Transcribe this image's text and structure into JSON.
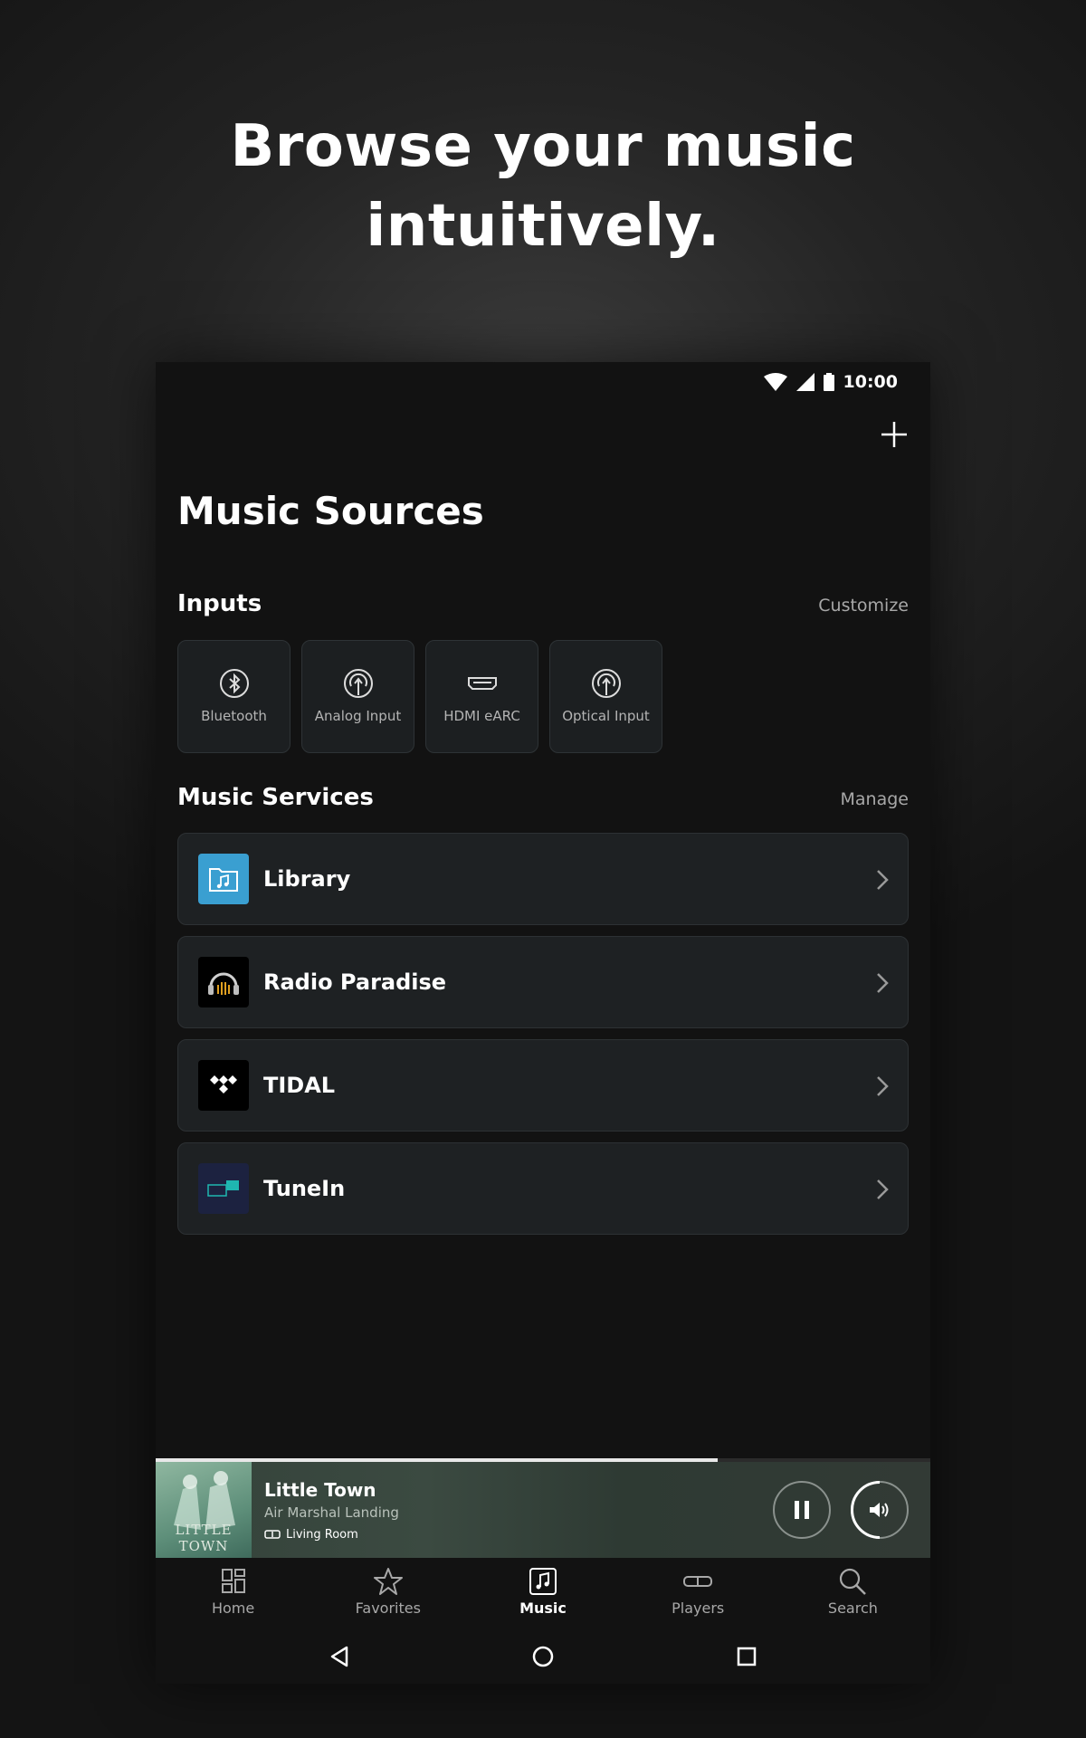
{
  "headline": {
    "line1": "Browse your music",
    "line2": "intuitively."
  },
  "status_bar": {
    "time": "10:00",
    "icons": [
      "wifi-icon",
      "signal-icon",
      "battery-icon"
    ]
  },
  "header": {
    "add_icon": "plus-icon",
    "title": "Music Sources"
  },
  "inputs": {
    "title": "Inputs",
    "action": "Customize",
    "items": [
      {
        "label": "Bluetooth",
        "icon": "bluetooth-icon"
      },
      {
        "label": "Analog Input",
        "icon": "analog-input-icon"
      },
      {
        "label": "HDMI eARC",
        "icon": "hdmi-icon"
      },
      {
        "label": "Optical Input",
        "icon": "optical-input-icon"
      }
    ]
  },
  "services": {
    "title": "Music Services",
    "action": "Manage",
    "items": [
      {
        "label": "Library",
        "icon": "library-folder-icon",
        "color": "#3a9fd1"
      },
      {
        "label": "Radio Paradise",
        "icon": "radio-paradise-logo",
        "color": "#000000"
      },
      {
        "label": "TIDAL",
        "icon": "tidal-logo",
        "color": "#000000"
      },
      {
        "label": "TuneIn",
        "icon": "tunein-logo",
        "color": "#1c2240"
      }
    ]
  },
  "now_playing": {
    "title": "Little Town",
    "artist": "Air Marshal Landing",
    "room": "Living Room",
    "album_art_text": "LITTLE TOWN",
    "progress": 0.725,
    "volume_level": 0.5,
    "pause_icon": "pause-icon",
    "volume_icon": "volume-icon"
  },
  "tabs": [
    {
      "label": "Home",
      "icon": "home-icon",
      "active": false
    },
    {
      "label": "Favorites",
      "icon": "star-icon",
      "active": false
    },
    {
      "label": "Music",
      "icon": "music-icon",
      "active": true
    },
    {
      "label": "Players",
      "icon": "players-icon",
      "active": false
    },
    {
      "label": "Search",
      "icon": "search-icon",
      "active": false
    }
  ],
  "system_nav": [
    "back-icon",
    "home-circle-icon",
    "recents-icon"
  ],
  "colors": {
    "background": "#121212",
    "card": "#1e2123",
    "accent_library": "#3a9fd1",
    "tunein_teal": "#1fb7b0"
  }
}
